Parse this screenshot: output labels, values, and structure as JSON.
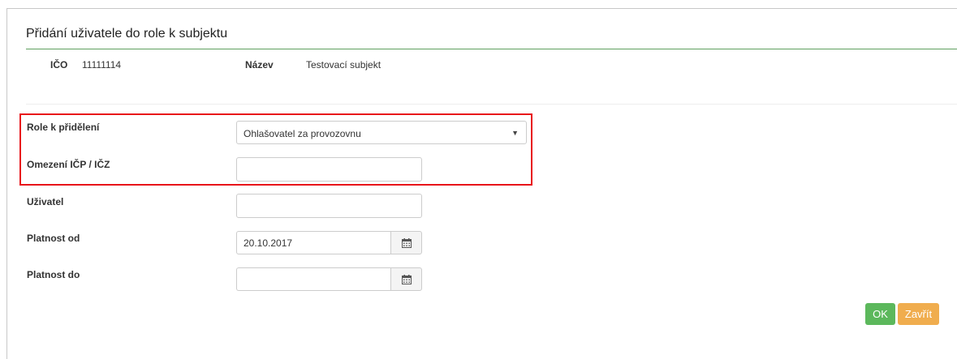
{
  "dialog": {
    "title": "Přidání uživatele do role k subjektu"
  },
  "subject": {
    "ico_label": "IČO",
    "ico_value": "11111114",
    "name_label": "Název",
    "name_value": "Testovací subjekt"
  },
  "form": {
    "role_label": "Role k přidělení",
    "role_selected": "Ohlašovatel za provozovnu",
    "restriction_label": "Omezení IČP / IČZ",
    "restriction_value": "",
    "user_label": "Uživatel",
    "user_value": "",
    "valid_from_label": "Platnost od",
    "valid_from_value": "20.10.2017",
    "valid_to_label": "Platnost do",
    "valid_to_value": ""
  },
  "buttons": {
    "ok_label": "OK",
    "close_label": "Zavřít"
  },
  "icons": {
    "select_caret": "▼",
    "calendar": "calendar-icon"
  },
  "colors": {
    "highlight": "#e8131a",
    "title_rule": "#5fa05f",
    "ok_button": "#5cb85c",
    "close_button": "#f0ad4e"
  }
}
